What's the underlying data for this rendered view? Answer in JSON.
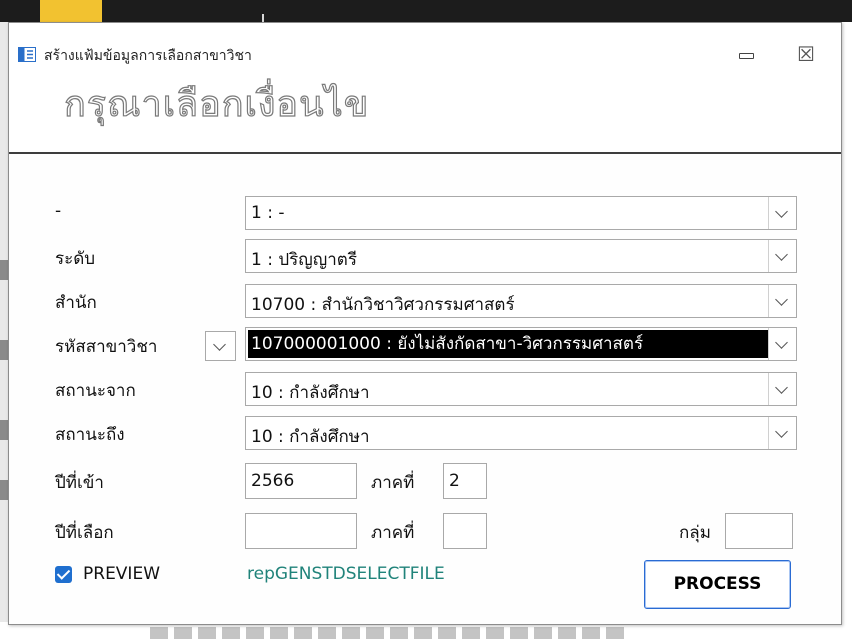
{
  "window": {
    "title": "สร้างแฟ้มข้อมูลการเลือกสาขาวิชา",
    "close_symbol": "☒"
  },
  "header": {
    "heading": "กรุณาเลือกเงื่อนไข"
  },
  "form": {
    "field1": {
      "label": "-",
      "value": "1 : -"
    },
    "level": {
      "label": "ระดับ",
      "value": "1 : ปริญญาตรี"
    },
    "office": {
      "label": "สำนัก",
      "value": "10700 : สำนักวิชาวิศวกรรมศาสตร์"
    },
    "major_code": {
      "label": "รหัสสาขาวิชา",
      "value": "107000001000 : ยังไม่สังกัดสาขา-วิศวกรรมศาสตร์"
    },
    "status_from": {
      "label": "สถานะจาก",
      "value": "10 : กำลังศึกษา"
    },
    "status_to": {
      "label": "สถานะถึง",
      "value": "10 : กำลังศึกษา"
    },
    "entry_year": {
      "label": "ปีที่เข้า",
      "value": "2566"
    },
    "entry_term": {
      "label": "ภาคที่",
      "value": "2"
    },
    "select_year": {
      "label": "ปีที่เลือก",
      "value": ""
    },
    "select_term": {
      "label": "ภาคที่",
      "value": ""
    },
    "group": {
      "label": "กลุ่ม",
      "value": ""
    }
  },
  "footer": {
    "preview_label": "PREVIEW",
    "preview_checked": true,
    "report_name": "repGENSTDSELECTFILE",
    "process_label": "PROCESS"
  },
  "colors": {
    "accent": "#1f6fcf",
    "report_text": "#20837a",
    "selection_bg": "#000000"
  },
  "icons": [
    "form-icon",
    "minimize-icon",
    "close-icon",
    "chevron-down-icon",
    "checkbox-checked-icon"
  ]
}
